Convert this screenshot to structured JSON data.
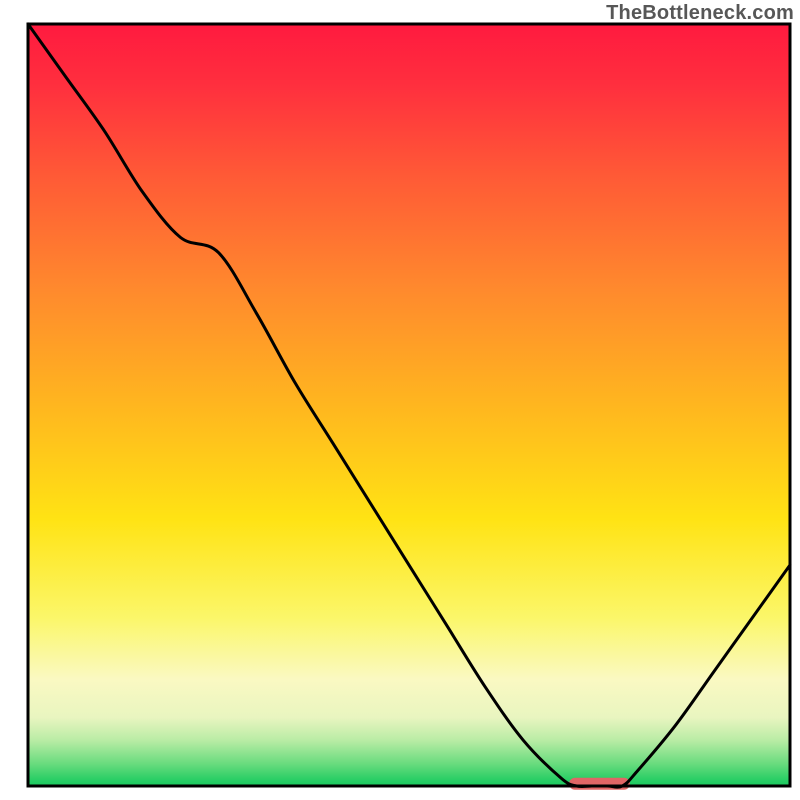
{
  "watermark": "TheBottleneck.com",
  "chart_data": {
    "type": "line",
    "title": "",
    "xlabel": "",
    "ylabel": "",
    "xlim": [
      0,
      100
    ],
    "ylim": [
      0,
      100
    ],
    "x": [
      0,
      5,
      10,
      15,
      20,
      25,
      30,
      35,
      40,
      45,
      50,
      55,
      60,
      65,
      70,
      72,
      74,
      76,
      78,
      80,
      85,
      90,
      95,
      100
    ],
    "values": [
      100,
      93,
      86,
      78,
      72,
      70,
      62,
      53,
      45,
      37,
      29,
      21,
      13,
      6,
      1,
      0,
      0,
      0,
      0,
      2,
      8,
      15,
      22,
      29
    ],
    "highlight_range_x": [
      71,
      79
    ],
    "gradient_stops": [
      {
        "offset": 0.0,
        "color": "#ff1a3f"
      },
      {
        "offset": 0.08,
        "color": "#ff2f3e"
      },
      {
        "offset": 0.2,
        "color": "#ff5a36"
      },
      {
        "offset": 0.35,
        "color": "#ff8a2d"
      },
      {
        "offset": 0.5,
        "color": "#ffb61f"
      },
      {
        "offset": 0.65,
        "color": "#ffe314"
      },
      {
        "offset": 0.78,
        "color": "#fbf76a"
      },
      {
        "offset": 0.86,
        "color": "#faf9c2"
      },
      {
        "offset": 0.91,
        "color": "#e9f5c0"
      },
      {
        "offset": 0.94,
        "color": "#b9eca5"
      },
      {
        "offset": 0.97,
        "color": "#6bdc7f"
      },
      {
        "offset": 0.99,
        "color": "#2ecf67"
      },
      {
        "offset": 1.0,
        "color": "#19c95f"
      }
    ],
    "highlight_color": "#e06666",
    "curve_color": "#000000",
    "axis_color": "#000000"
  }
}
